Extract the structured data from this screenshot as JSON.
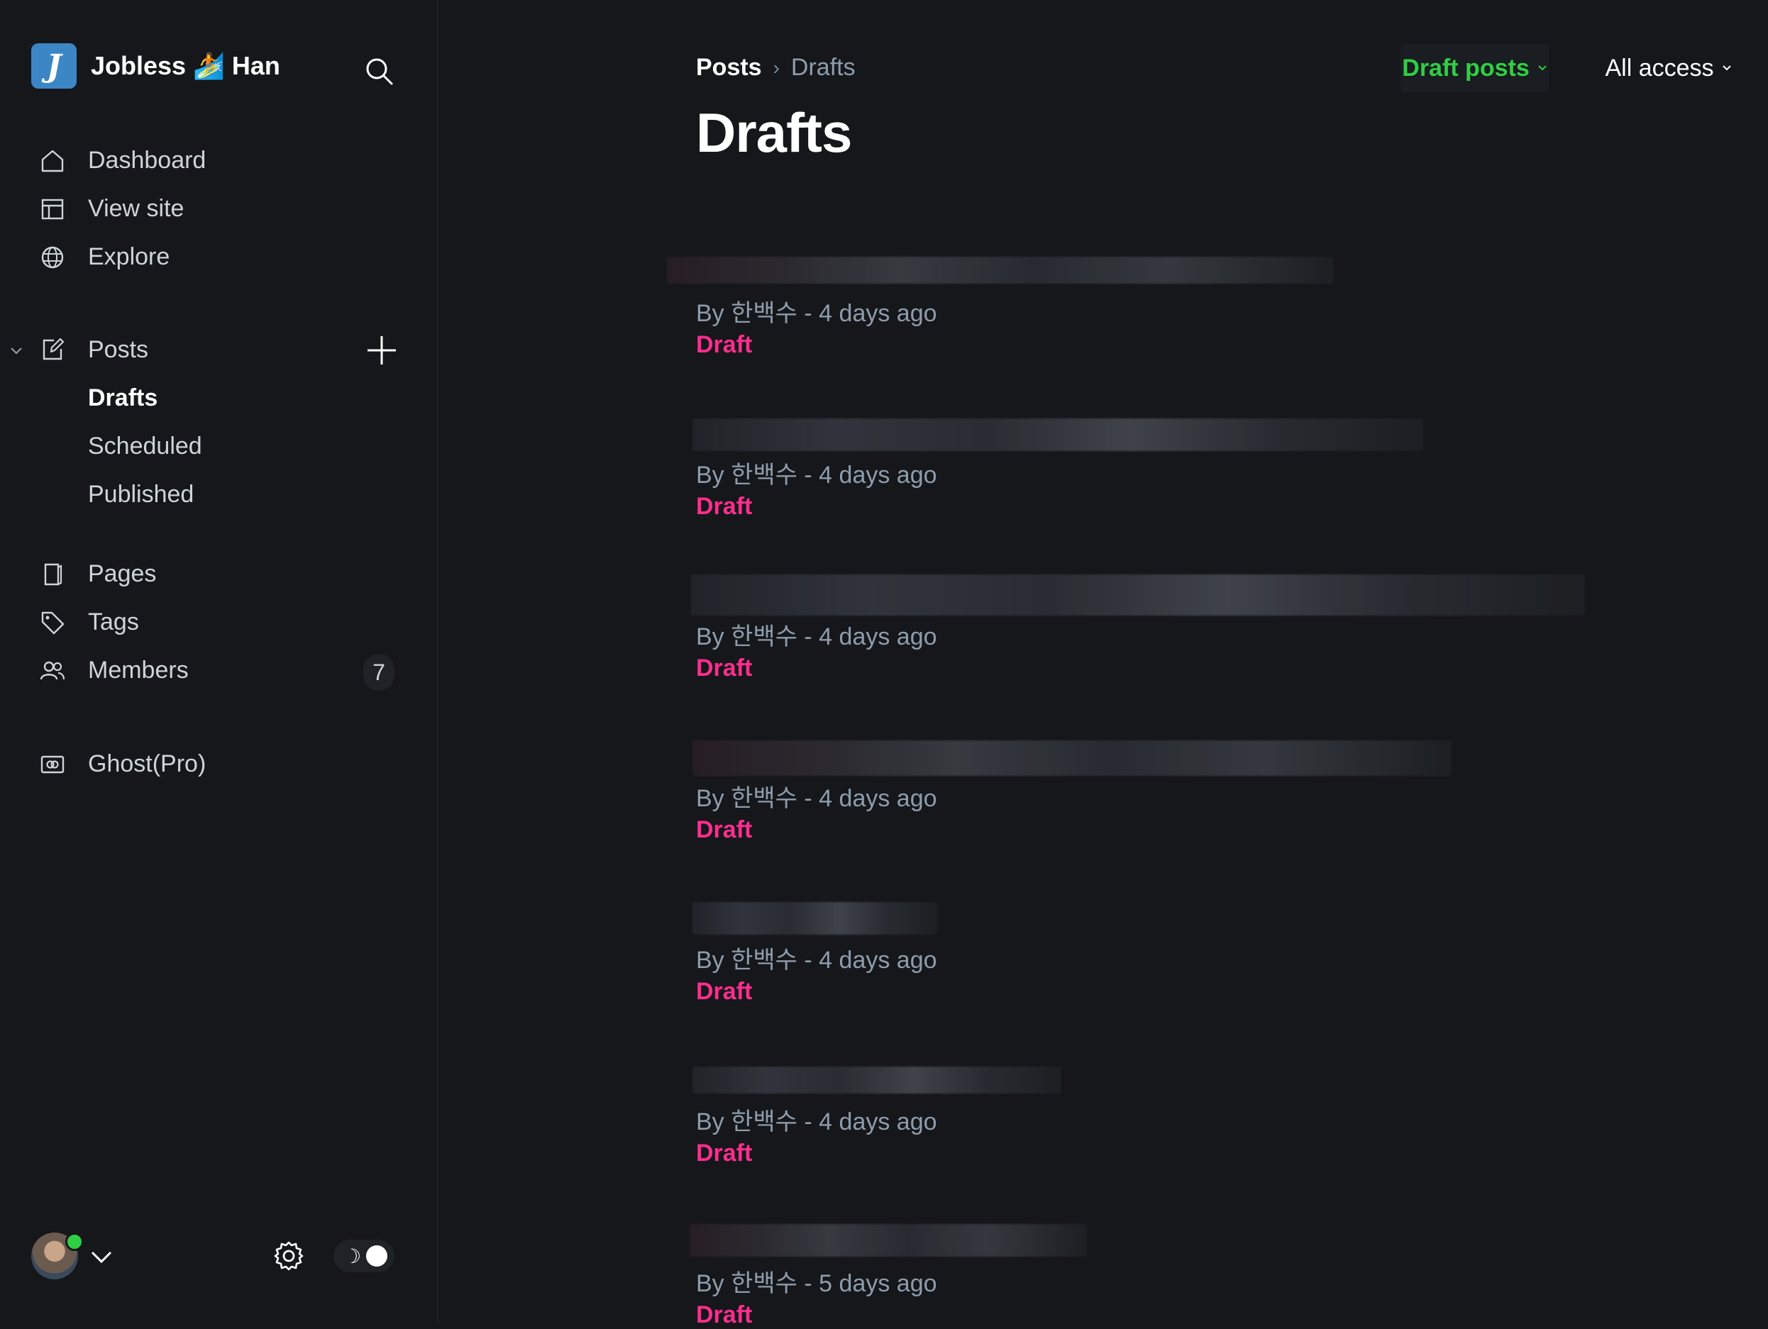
{
  "brand": {
    "logo_letter": "J",
    "name": "Jobless 🏄 Han"
  },
  "sidebar": {
    "top_nav": [
      {
        "label": "Dashboard",
        "icon": "home-icon"
      },
      {
        "label": "View site",
        "icon": "layout-icon"
      },
      {
        "label": "Explore",
        "icon": "globe-icon"
      }
    ],
    "posts": {
      "label": "Posts",
      "icon": "pencil-edit-icon",
      "subitems": [
        {
          "label": "Drafts",
          "active": true
        },
        {
          "label": "Scheduled",
          "active": false
        },
        {
          "label": "Published",
          "active": false
        }
      ]
    },
    "content_nav": [
      {
        "label": "Pages",
        "icon": "page-icon"
      },
      {
        "label": "Tags",
        "icon": "tag-icon"
      },
      {
        "label": "Members",
        "icon": "members-icon",
        "badge": "7"
      }
    ],
    "billing": {
      "label": "Ghost(Pro)",
      "icon": "ghost-pro-icon"
    }
  },
  "header": {
    "breadcrumb": {
      "parent": "Posts",
      "separator": "›",
      "current": "Drafts"
    },
    "title": "Drafts",
    "filters": {
      "type": "Draft posts",
      "access": "All access"
    }
  },
  "posts": [
    {
      "meta": "By 한백수 - 4 days ago",
      "status": "Draft"
    },
    {
      "meta": "By 한백수 - 4 days ago",
      "status": "Draft"
    },
    {
      "meta": "By 한백수 - 4 days ago",
      "status": "Draft"
    },
    {
      "meta": "By 한백수 - 4 days ago",
      "status": "Draft"
    },
    {
      "meta": "By 한백수 - 4 days ago",
      "status": "Draft"
    },
    {
      "meta": "By 한백수 - 4 days ago",
      "status": "Draft"
    },
    {
      "meta": "By 한백수 - 5 days ago",
      "status": "Draft"
    }
  ],
  "footer": {
    "theme_icon": "moon-icon"
  },
  "colors": {
    "background": "#15171a",
    "accent_green": "#30cf43",
    "draft_pink": "#fb2d8d",
    "muted_text": "#8e9cac"
  }
}
